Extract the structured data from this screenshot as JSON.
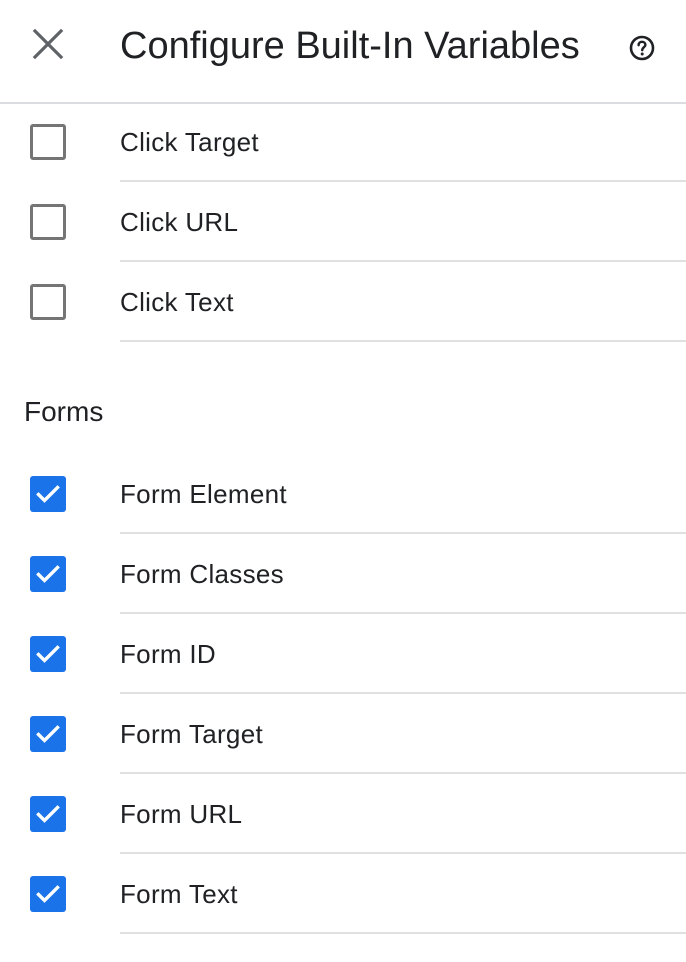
{
  "header": {
    "close_icon": "close-icon",
    "title": "Configure Built-In Variables",
    "help_icon": "help-circle-icon"
  },
  "clicks": {
    "items": [
      {
        "label": "Click Target",
        "checked": false
      },
      {
        "label": "Click URL",
        "checked": false
      },
      {
        "label": "Click Text",
        "checked": false
      }
    ]
  },
  "forms": {
    "section_title": "Forms",
    "items": [
      {
        "label": "Form Element",
        "checked": true
      },
      {
        "label": "Form Classes",
        "checked": true
      },
      {
        "label": "Form ID",
        "checked": true
      },
      {
        "label": "Form Target",
        "checked": true
      },
      {
        "label": "Form URL",
        "checked": true
      },
      {
        "label": "Form Text",
        "checked": true
      }
    ]
  },
  "colors": {
    "checkbox_checked": "#1a73e8",
    "checkbox_unchecked_border": "#757575",
    "divider": "#e0e0e0",
    "text": "#202124"
  }
}
